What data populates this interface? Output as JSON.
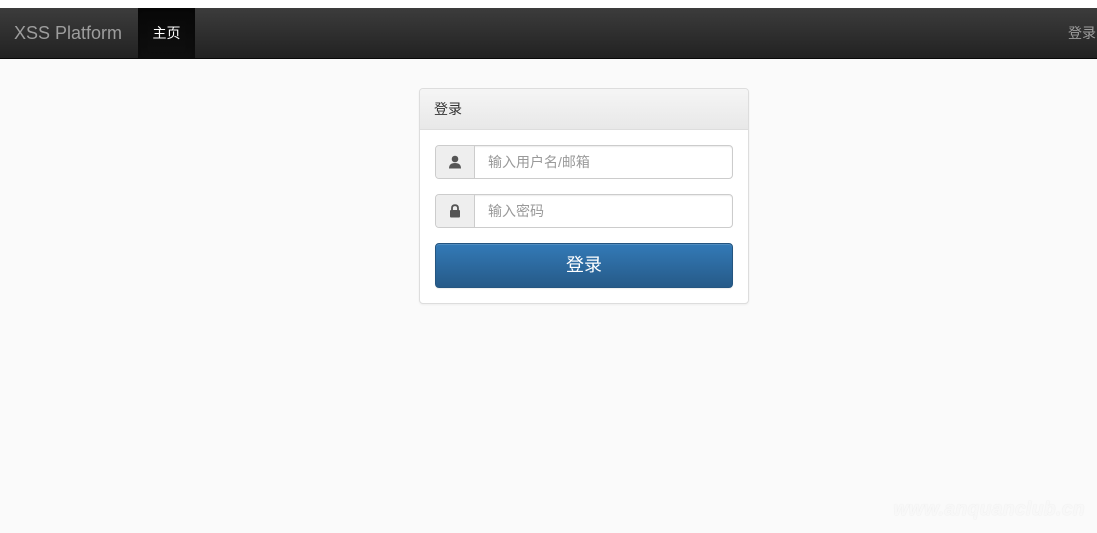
{
  "navbar": {
    "brand": "XSS Platform",
    "home_label": "主页",
    "login_label": "登录"
  },
  "login_panel": {
    "title": "登录",
    "username_placeholder": "输入用户名/邮箱",
    "password_placeholder": "输入密码",
    "submit_label": "登录"
  },
  "icons": {
    "username_icon": "user-icon",
    "password_icon": "lock-icon"
  },
  "colors": {
    "navbar": "#222222",
    "primary_button": "#337ab7",
    "background": "#fafafa"
  },
  "watermark": "www.anquanclub.cn"
}
